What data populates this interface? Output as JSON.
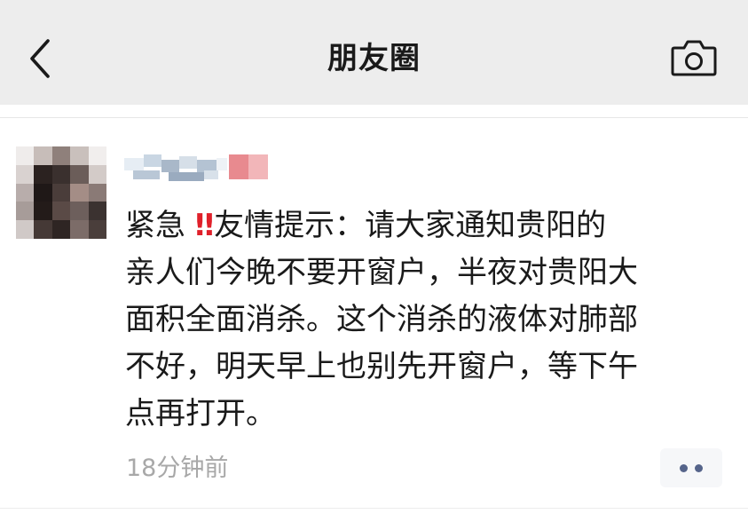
{
  "header": {
    "title": "朋友圈",
    "back_icon": "chevron-left-icon",
    "camera_icon": "camera-icon"
  },
  "post": {
    "author": "",
    "text_lines": [
      "紧急 ‼️友情提示：请大家通知贵阳的",
      "亲人们今晚不要开窗户，半夜对贵阳大",
      "面积全面消杀。这个消杀的液体对肺部",
      "不好，明天早上也别先开窗户，等下午",
      "点再打开。"
    ],
    "prefix": "紧急 ",
    "emoji": "‼",
    "after_emoji": "友情提示：请大家通知贵阳的",
    "rest": "亲人们今晚不要开窗户，半夜对贵阳大\n面积全面消杀。这个消杀的液体对肺部\n不好，明天早上也别先开窗户，等下午\n点再打开。",
    "timestamp": "18分钟前",
    "more_icon": "more-dots-icon"
  },
  "colors": {
    "header_bg": "#ededed",
    "text": "#1a1a1a",
    "timestamp": "#a8a8a8",
    "emoji_red": "#e0202a",
    "dots": "#55648a"
  }
}
